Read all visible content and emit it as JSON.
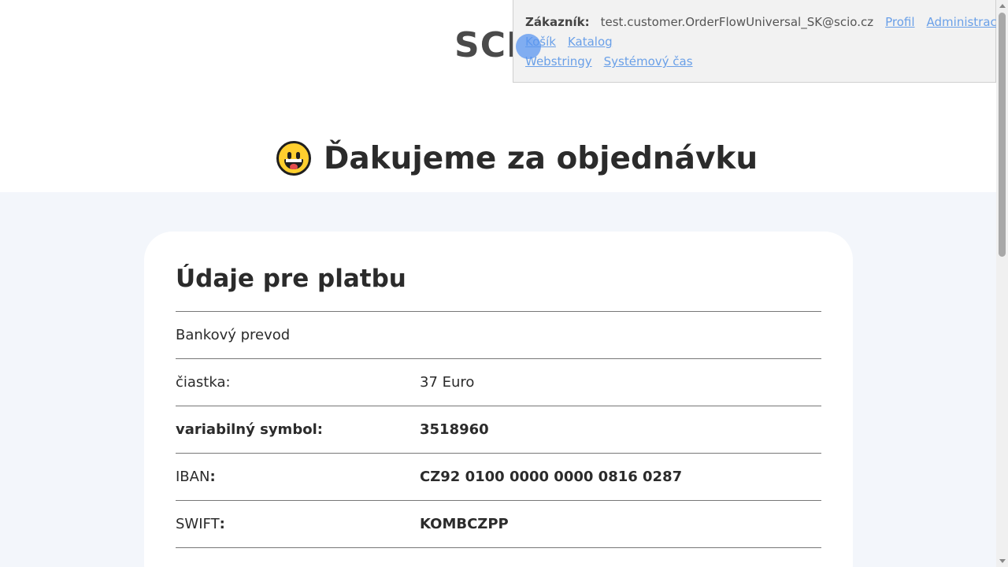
{
  "header": {
    "logo": "SCI",
    "emoji": "grinning-face-emoji",
    "title": "Ďakujeme za objednávku"
  },
  "devbar": {
    "customer_label": "Zákazník:",
    "customer_email": "test.customer.OrderFlowUniversal_SK@scio.cz",
    "links": {
      "profile": "Profil",
      "admin": "Administrace",
      "cart": "Košík",
      "catalog": "Katalog",
      "webstrings": "Webstringy",
      "system_time": "Systémový čas"
    }
  },
  "payment": {
    "heading": "Údaje pre platbu",
    "method": "Bankový prevod",
    "rows": [
      {
        "label": "čiastka:",
        "value": "37 Euro"
      },
      {
        "label": "variabilný symbol:",
        "value": "3518960"
      },
      {
        "label": "IBAN",
        "colon": ":",
        "value": "CZ92 0100 0000 0000 0816 0287"
      },
      {
        "label": "SWIFT",
        "colon": ":",
        "value": "KOMBCZPP"
      }
    ]
  },
  "colors": {
    "link": "#6aa0e8",
    "page_bg": "#f3f6fb",
    "emoji_face": "#ffcf2e"
  }
}
